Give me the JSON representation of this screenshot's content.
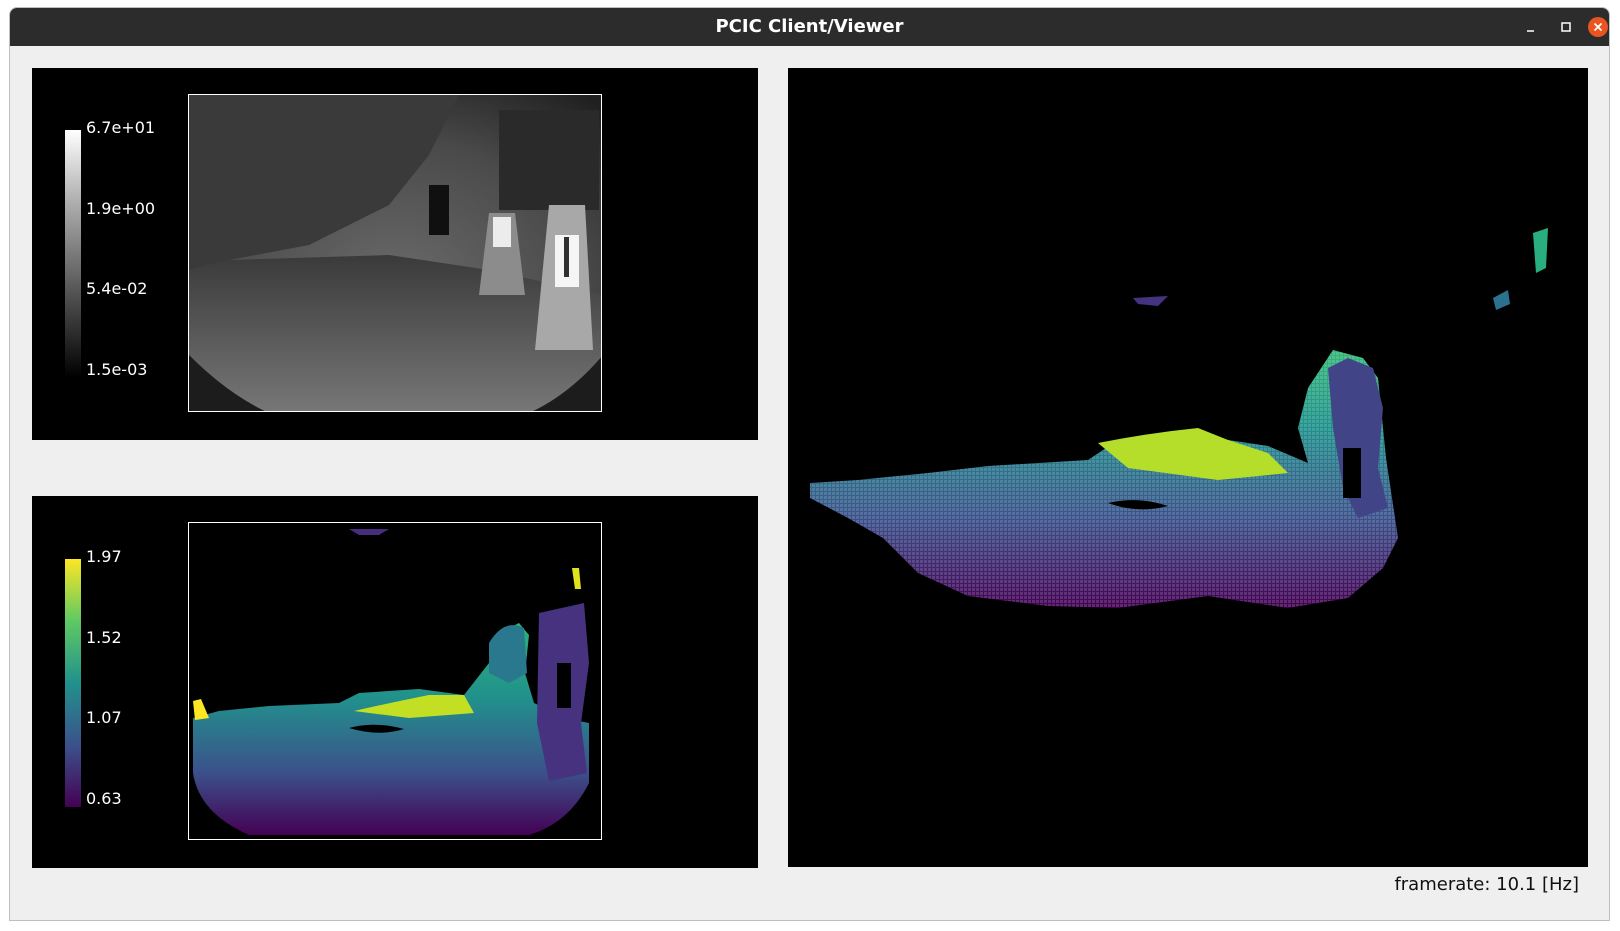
{
  "window": {
    "title": "PCIC Client/Viewer",
    "controls": {
      "minimize_icon": "minimize-icon",
      "maximize_icon": "maximize-icon",
      "close_icon": "close-icon"
    }
  },
  "amplitude_view": {
    "colormap": "gray",
    "colorbar_ticks": [
      "6.7e+01",
      "1.9e+00",
      "5.4e-02",
      "1.5e-03"
    ]
  },
  "distance_view": {
    "colormap": "viridis",
    "colorbar_ticks": [
      "1.97",
      "1.52",
      "1.07",
      "0.63"
    ]
  },
  "pointcloud_view": {
    "colormap": "viridis"
  },
  "status": {
    "framerate_label": "framerate: 10.1 [Hz]"
  },
  "colors": {
    "titlebar": "#2c2c2c",
    "window_bg": "#efefef",
    "close_button": "#e95420",
    "panel_bg": "#000000"
  }
}
